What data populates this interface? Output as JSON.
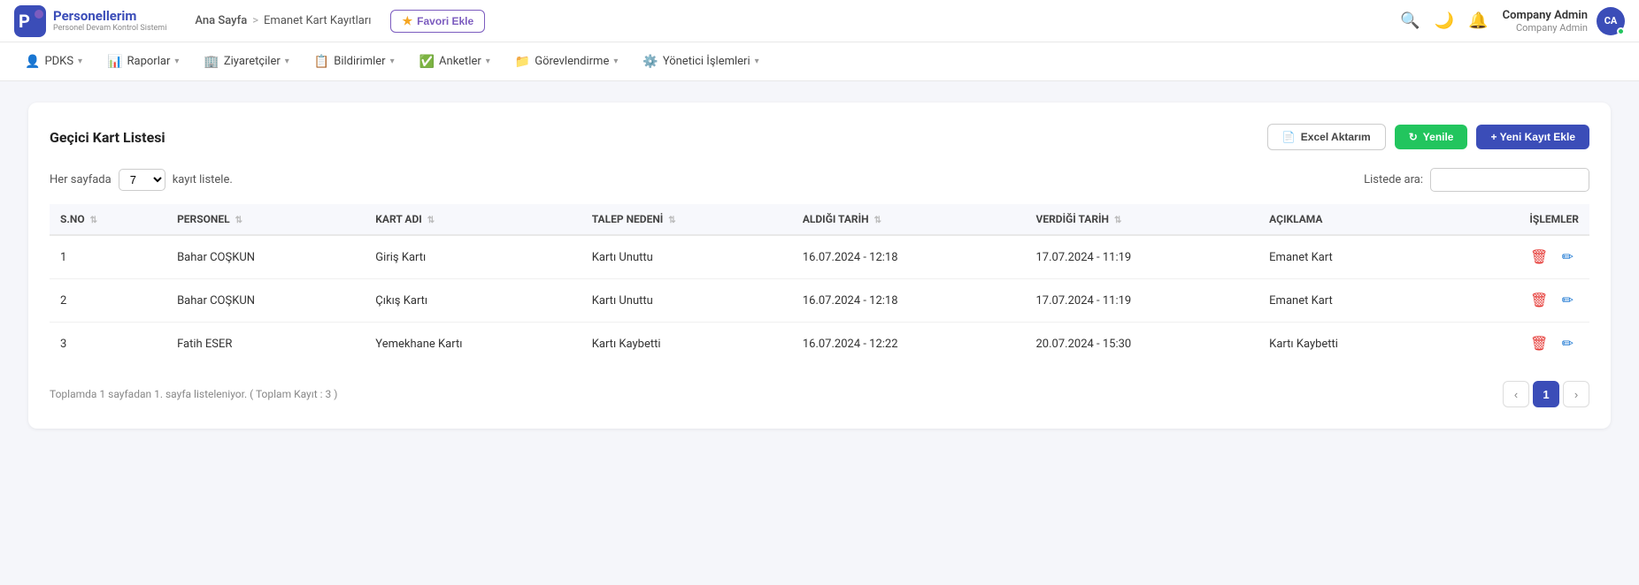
{
  "app": {
    "logo_main": "Personellerim",
    "logo_sub": "Personel Devam Kontrol Sistemi"
  },
  "breadcrumb": {
    "home": "Ana Sayfa",
    "separator": ">",
    "current": "Emanet Kart Kayıtları"
  },
  "favori_btn": "Favori Ekle",
  "header_icons": {
    "search": "🔍",
    "theme": "🌙",
    "bell": "🔔"
  },
  "user": {
    "name": "Company Admin",
    "role": "Company Admin",
    "initials": "CA"
  },
  "nav": [
    {
      "label": "PDKS",
      "icon": "👤"
    },
    {
      "label": "Raporlar",
      "icon": "📊"
    },
    {
      "label": "Ziyaretçiler",
      "icon": "🏢"
    },
    {
      "label": "Bildirimler",
      "icon": "📋"
    },
    {
      "label": "Anketler",
      "icon": "✅"
    },
    {
      "label": "Görevlendirme",
      "icon": "📁"
    },
    {
      "label": "Yönetici İşlemleri",
      "icon": "⚙️"
    }
  ],
  "page_title": "Geçici Kart Listesi",
  "buttons": {
    "excel": "Excel Aktarım",
    "yenile": "Yenile",
    "yeni": "+ Yeni Kayıt Ekle"
  },
  "table_controls": {
    "per_page_label": "Her sayfada",
    "per_page_value": "7",
    "per_page_suffix": "kayıt listele.",
    "search_label": "Listede ara:",
    "search_placeholder": ""
  },
  "table": {
    "columns": [
      {
        "key": "sno",
        "label": "S.NO"
      },
      {
        "key": "personel",
        "label": "PERSONEL"
      },
      {
        "key": "kart_adi",
        "label": "KART ADI"
      },
      {
        "key": "talep_nedeni",
        "label": "TALEP NEDENİ"
      },
      {
        "key": "aldigi_tarih",
        "label": "ALDIĞI TARİH"
      },
      {
        "key": "verdigi_tarih",
        "label": "VERDİĞİ TARİH"
      },
      {
        "key": "aciklama",
        "label": "AÇIKLAMA"
      },
      {
        "key": "islemler",
        "label": "İŞLEMLER"
      }
    ],
    "rows": [
      {
        "sno": "1",
        "personel": "Bahar COŞKUN",
        "kart_adi": "Giriş Kartı",
        "talep_nedeni": "Kartı Unuttu",
        "aldigi_tarih": "16.07.2024 - 12:18",
        "verdigi_tarih": "17.07.2024 - 11:19",
        "aciklama": "Emanet Kart"
      },
      {
        "sno": "2",
        "personel": "Bahar COŞKUN",
        "kart_adi": "Çıkış Kartı",
        "talep_nedeni": "Kartı Unuttu",
        "aldigi_tarih": "16.07.2024 - 12:18",
        "verdigi_tarih": "17.07.2024 - 11:19",
        "aciklama": "Emanet Kart"
      },
      {
        "sno": "3",
        "personel": "Fatih ESER",
        "kart_adi": "Yemekhane Kartı",
        "talep_nedeni": "Kartı Kaybetti",
        "aldigi_tarih": "16.07.2024 - 12:22",
        "verdigi_tarih": "20.07.2024 - 15:30",
        "aciklama": "Kartı Kaybetti"
      }
    ]
  },
  "pagination": {
    "info": "Toplamda 1 sayfadan 1. sayfa listeleniyor. ( Toplam Kayıt : 3 )",
    "current_page": "1",
    "prev_label": "‹",
    "next_label": "›"
  }
}
